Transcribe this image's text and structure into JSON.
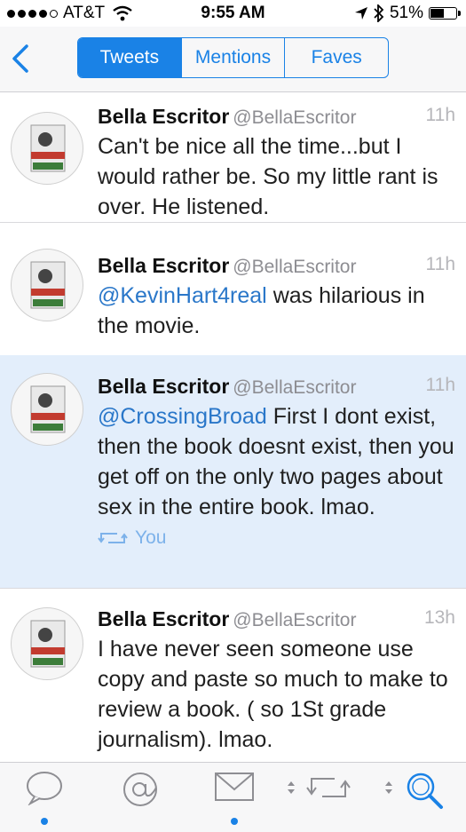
{
  "status_bar": {
    "carrier": "AT&T",
    "time": "9:55 AM",
    "battery": "51%",
    "battery_level": 0.51
  },
  "nav": {
    "tabs": [
      {
        "label": "Tweets",
        "active": true
      },
      {
        "label": "Mentions",
        "active": false
      },
      {
        "label": "Faves",
        "active": false
      }
    ]
  },
  "tweets": [
    {
      "name": "Bella Escritor",
      "handle": "@BellaEscritor",
      "time": "11h",
      "text_before": "",
      "mention": "",
      "text_after": "Can't be nice all the time...but I would rather be.  So my little rant is over. He listened."
    },
    {
      "name": "Bella Escritor",
      "handle": "@BellaEscritor",
      "time": "11h",
      "text_before": "",
      "mention": "@KevinHart4real",
      "text_after": " was hilarious in the movie."
    },
    {
      "name": "Bella Escritor",
      "handle": "@BellaEscritor",
      "time": "11h",
      "text_before": "",
      "mention": "@CrossingBroad",
      "text_after": " First I dont exist, then the book doesnt exist, then you get off on the only two pages about sex in the entire book.  lmao.",
      "retweeted_by": "You"
    },
    {
      "name": "Bella Escritor",
      "handle": "@BellaEscritor",
      "time": "13h",
      "text_before": "",
      "mention": "",
      "text_after": "I have never seen someone use copy and paste so much to make to review a book.  ( so 1St grade journalism).  lmao."
    }
  ],
  "tab_bar": {
    "icons": [
      "speech-bubble-icon",
      "at-icon",
      "envelope-icon",
      "retweet-icon",
      "search-icon"
    ],
    "accent": "#1a82e6"
  }
}
